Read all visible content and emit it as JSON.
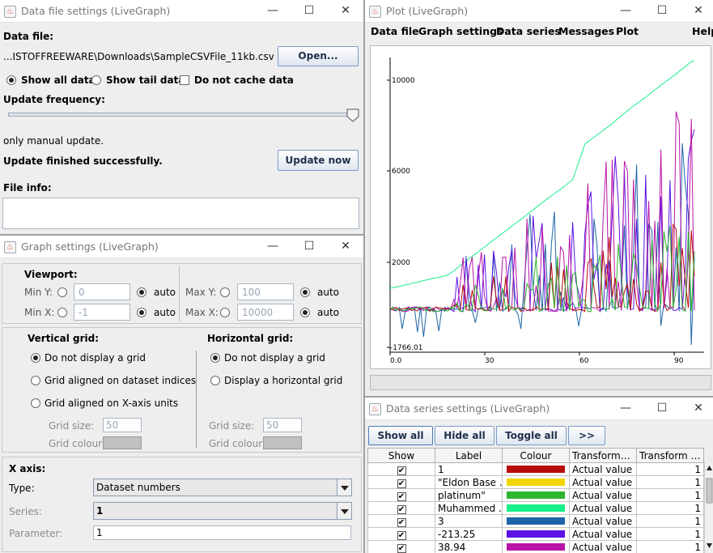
{
  "data_file_window": {
    "title": "Data file settings (LiveGraph)",
    "data_file_label": "Data file:",
    "file_path": "...ISTOFFREEWARE\\Downloads\\SampleCSVFile_11kb.csv",
    "open_button": "Open...",
    "show_all_label": "Show all data",
    "show_tail_label": "Show tail data",
    "no_cache_label": "Do not cache data",
    "update_frequency_label": "Update frequency:",
    "update_mode_text": "only manual update.",
    "status_text": "Update finished successfully.",
    "update_button": "Update now",
    "file_info_label": "File info:"
  },
  "graph_window": {
    "title": "Graph settings (LiveGraph)",
    "viewport_label": "Viewport:",
    "min_y_label": "Min Y:",
    "min_y_value": "0",
    "min_x_label": "Min X:",
    "min_x_value": "-1",
    "max_y_label": "Max Y:",
    "max_y_value": "100",
    "max_x_label": "Max X:",
    "max_x_value": "10000",
    "auto_label": "auto",
    "vertical_grid_label": "Vertical grid:",
    "v_opt_none": "Do not display a grid",
    "v_opt_indices": "Grid aligned on dataset indices",
    "v_opt_xaxis": "Grid aligned on X-axis units",
    "horizontal_grid_label": "Horizontal grid:",
    "h_opt_none": "Do not display a grid",
    "h_opt_display": "Display a horizontal grid",
    "grid_size_label": "Grid size:",
    "grid_size_value": "50",
    "grid_colour_label": "Grid colour:",
    "x_axis_label": "X axis:",
    "type_label": "Type:",
    "type_value": "Dataset numbers",
    "series_label": "Series:",
    "series_value": "1",
    "parameter_label": "Parameter:",
    "parameter_value": "1"
  },
  "plot_window": {
    "title": "Plot (LiveGraph)",
    "menu": [
      "Data file",
      "Graph settings",
      "Data series",
      "Messages",
      "Plot",
      "Help"
    ],
    "y_labels": [
      "10000",
      "6000",
      "2000",
      "-1766.01"
    ],
    "x_labels": [
      "0.0",
      "30",
      "60",
      "90"
    ]
  },
  "series_window": {
    "title": "Data series settings (LiveGraph)",
    "buttons": [
      "Show all",
      "Hide all",
      "Toggle all",
      ">>"
    ],
    "columns": [
      "Show",
      "Label",
      "Colour",
      "Transformati...",
      "Transform p..."
    ],
    "check_mark": "✔",
    "rows": [
      {
        "label": "1",
        "colour": "#b80c0c",
        "transform": "Actual value",
        "param": "1"
      },
      {
        "label": "\"Eldon Base ...",
        "colour": "#f2d600",
        "transform": "Actual value",
        "param": "1"
      },
      {
        "label": "platinum\"",
        "colour": "#2fb52f",
        "transform": "Actual value",
        "param": "1"
      },
      {
        "label": "Muhammed ...",
        "colour": "#18f08a",
        "transform": "Actual value",
        "param": "1"
      },
      {
        "label": "3",
        "colour": "#1c64a8",
        "transform": "Actual value",
        "param": "1"
      },
      {
        "label": "-213.25",
        "colour": "#5b13e6",
        "transform": "Actual value",
        "param": "1"
      },
      {
        "label": "38.94",
        "colour": "#b814a6",
        "transform": "Actual value",
        "param": "1"
      }
    ]
  },
  "title_glyphs": {
    "minimize": "—",
    "maximize": "☐",
    "close": "✕",
    "app_icon": "♨"
  }
}
